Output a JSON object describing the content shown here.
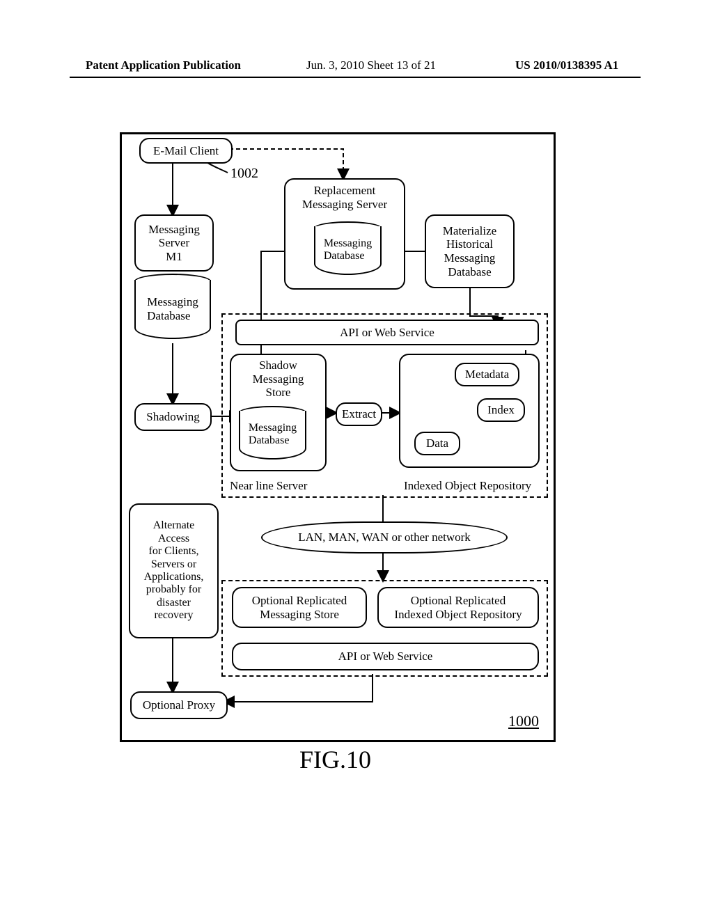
{
  "header": {
    "left": "Patent Application Publication",
    "center": "Jun. 3, 2010  Sheet 13 of 21",
    "right": "US 2010/0138395 A1"
  },
  "figure": {
    "caption": "FIG.10",
    "number": "1000",
    "ref_1002": "1002",
    "email_client": "E-Mail Client",
    "messaging_server": "Messaging\nServer\nM1",
    "messaging_database_1": "Messaging\nDatabase",
    "replacement_messaging_server": "Replacement\nMessaging Server",
    "messaging_database_2": "Messaging\nDatabase",
    "materialize": "Materialize\nHistorical\nMessaging\nDatabase",
    "api_1": "API or Web Service",
    "shadowing": "Shadowing",
    "shadow_store": "Shadow\nMessaging\nStore",
    "messaging_database_3": "Messaging\nDatabase",
    "extract": "Extract",
    "metadata": "Metadata",
    "index": "Index",
    "data": "Data",
    "ior_label": "Indexed Object Repository",
    "nearline": "Near line Server",
    "alternate_access": "Alternate\nAccess\nfor Clients,\nServers or\nApplications,\nprobably for\ndisaster\nrecovery",
    "network": "LAN, MAN, WAN or other network",
    "opt_msg_store": "Optional Replicated\nMessaging Store",
    "opt_ior": "Optional Replicated\nIndexed Object Repository",
    "api_2": "API or Web Service",
    "optional_proxy": "Optional Proxy"
  }
}
